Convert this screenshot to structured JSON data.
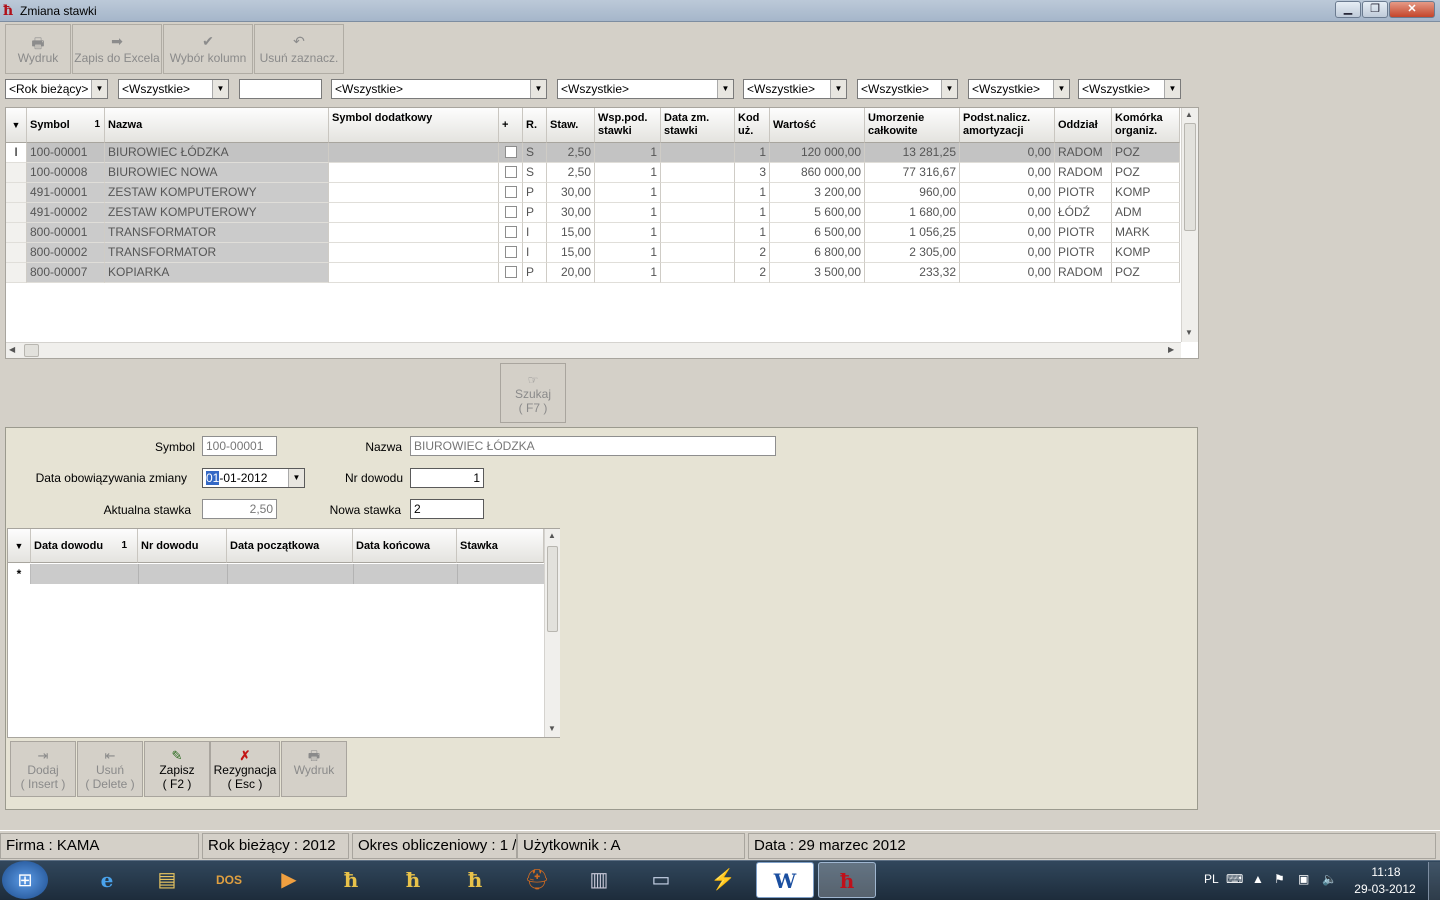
{
  "window": {
    "title": "Zmiana stawki",
    "controls": {
      "minimize": "▁",
      "maximize": "❐",
      "close": "✕"
    }
  },
  "toolbar": [
    {
      "id": "wydruk",
      "label": "Wydruk",
      "icon": "printer-icon"
    },
    {
      "id": "zapis",
      "label": "Zapis do Excela",
      "icon": "export-icon"
    },
    {
      "id": "wybor",
      "label": "Wybór kolumn",
      "icon": "check-icon"
    },
    {
      "id": "usun",
      "label": "Usuń zaznacz.",
      "icon": "undo-icon"
    }
  ],
  "filters": {
    "year": "<Rok bieżący>",
    "f1": "<Wszystkie>",
    "text": "",
    "f2": "<Wszystkie>",
    "f3": "<Wszystkie>",
    "f4": "<Wszystkie>",
    "f5": "<Wszystkie>",
    "f6": "<Wszystkie>",
    "f7": "<Wszystkie>",
    "f8": "<Wszystkie>"
  },
  "grid": {
    "columns": [
      "Symbol",
      "Nazwa",
      "Symbol dodatkowy",
      "+",
      "R.",
      "Staw.",
      "Wsp.pod. stawki",
      "Data zm. stawki",
      "Kod uż.",
      "Wartość",
      "Umorzenie całkowite",
      "Podst.nalicz. amortyzacji",
      "Oddział",
      "Komórka organiz."
    ],
    "sort_indicator": "1",
    "rows": [
      {
        "symbol": "100-00001",
        "nazwa": "BIUROWIEC ŁÓDZKA",
        "dod": "",
        "r": "S",
        "staw": "2,50",
        "wsp": "1",
        "data": "",
        "kod": "1",
        "wartosc": "120 000,00",
        "umorz": "13 281,25",
        "podst": "0,00",
        "oddzial": "RADOM",
        "komorka": "POZ"
      },
      {
        "symbol": "100-00008",
        "nazwa": "BIUROWIEC NOWA",
        "dod": "",
        "r": "S",
        "staw": "2,50",
        "wsp": "1",
        "data": "",
        "kod": "3",
        "wartosc": "860 000,00",
        "umorz": "77 316,67",
        "podst": "0,00",
        "oddzial": "RADOM",
        "komorka": "POZ"
      },
      {
        "symbol": "491-00001",
        "nazwa": "ZESTAW KOMPUTEROWY",
        "dod": "",
        "r": "P",
        "staw": "30,00",
        "wsp": "1",
        "data": "",
        "kod": "1",
        "wartosc": "3 200,00",
        "umorz": "960,00",
        "podst": "0,00",
        "oddzial": "PIOTR",
        "komorka": "KOMP"
      },
      {
        "symbol": "491-00002",
        "nazwa": "ZESTAW KOMPUTEROWY",
        "dod": "",
        "r": "P",
        "staw": "30,00",
        "wsp": "1",
        "data": "",
        "kod": "1",
        "wartosc": "5 600,00",
        "umorz": "1 680,00",
        "podst": "0,00",
        "oddzial": "ŁÓDŹ",
        "komorka": "ADM"
      },
      {
        "symbol": "800-00001",
        "nazwa": "TRANSFORMATOR",
        "dod": "",
        "r": "I",
        "staw": "15,00",
        "wsp": "1",
        "data": "",
        "kod": "1",
        "wartosc": "6 500,00",
        "umorz": "1 056,25",
        "podst": "0,00",
        "oddzial": "PIOTR",
        "komorka": "MARK"
      },
      {
        "symbol": "800-00002",
        "nazwa": "TRANSFORMATOR",
        "dod": "",
        "r": "I",
        "staw": "15,00",
        "wsp": "1",
        "data": "",
        "kod": "2",
        "wartosc": "6 800,00",
        "umorz": "2 305,00",
        "podst": "0,00",
        "oddzial": "PIOTR",
        "komorka": "KOMP"
      },
      {
        "symbol": "800-00007",
        "nazwa": "KOPIARKA",
        "dod": "",
        "r": "P",
        "staw": "20,00",
        "wsp": "1",
        "data": "",
        "kod": "2",
        "wartosc": "3 500,00",
        "umorz": "233,32",
        "podst": "0,00",
        "oddzial": "RADOM",
        "komorka": "POZ"
      }
    ]
  },
  "search": {
    "label": "Szukaj",
    "key": "( F7 )"
  },
  "form": {
    "symbol_label": "Symbol",
    "symbol": "100-00001",
    "nazwa_label": "Nazwa",
    "nazwa": "BIUROWIEC ŁÓDZKA",
    "data_label": "Data obowiązywania zmiany",
    "data_day": "01",
    "data_rest": "-01-2012",
    "nr_label": "Nr dowodu",
    "nr": "1",
    "akt_label": "Aktualna stawka",
    "akt": "2,50",
    "nowa_label": "Nowa stawka",
    "nowa": "2"
  },
  "grid2": {
    "columns": [
      "Data dowodu",
      "Nr dowodu",
      "Data początkowa",
      "Data końcowa",
      "Stawka"
    ],
    "sort_indicator": "1",
    "new_row_marker": "*"
  },
  "actions": [
    {
      "id": "dodaj",
      "label": "Dodaj",
      "key": "( Insert )",
      "icon": "add-icon",
      "enabled": false
    },
    {
      "id": "usun",
      "label": "Usuń",
      "key": "( Delete )",
      "icon": "remove-icon",
      "enabled": false
    },
    {
      "id": "zapisz",
      "label": "Zapisz",
      "key": "( F2 )",
      "icon": "save-icon",
      "enabled": true
    },
    {
      "id": "rezygnacja",
      "label": "Rezygnacja",
      "key": "( Esc )",
      "icon": "cancel-icon",
      "enabled": true
    },
    {
      "id": "wydruk",
      "label": "Wydruk",
      "key": "",
      "icon": "printer-icon",
      "enabled": false
    }
  ],
  "status": {
    "firma": "Firma : KAMA",
    "rok": "Rok bieżący : 2012",
    "okres": "Okres obliczeniowy : 1 /",
    "user": "Użytkownik : A",
    "data": "Data : 29 marzec 2012"
  },
  "taskbar": {
    "lang": "PL",
    "time": "11:18",
    "date": "29-03-2012"
  }
}
